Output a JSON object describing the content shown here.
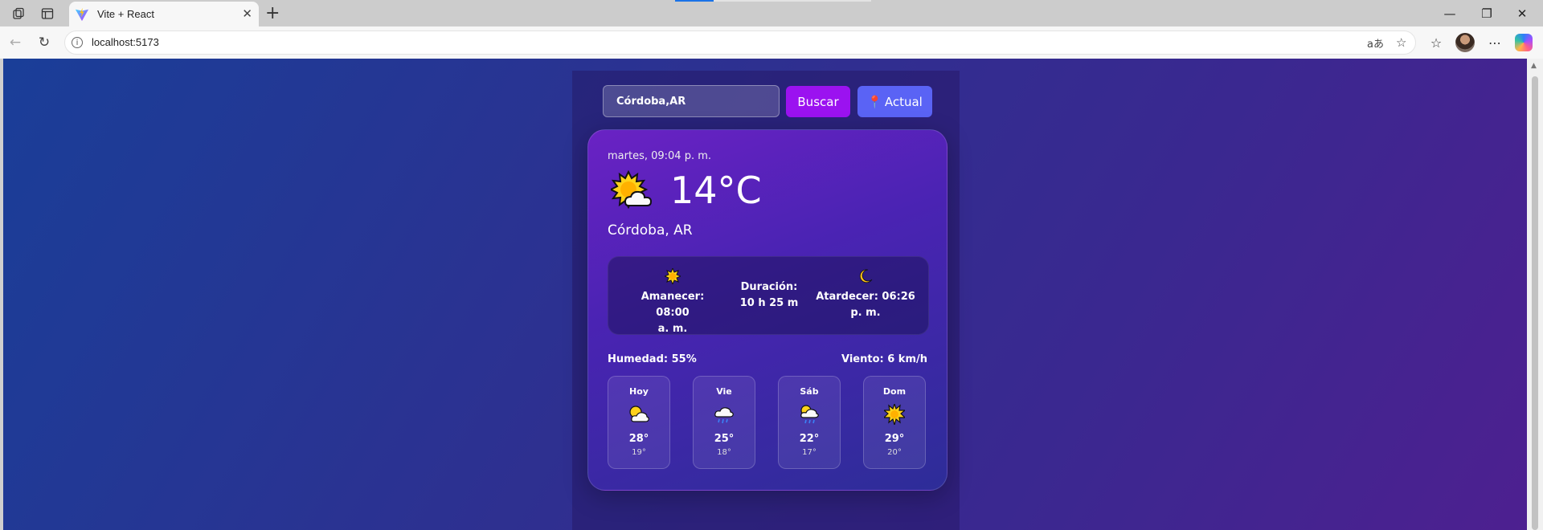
{
  "browser": {
    "tab_title": "Vite + React",
    "url": "localhost:5173"
  },
  "app": {
    "search": {
      "value": "Córdoba,AR",
      "search_label": "Buscar",
      "current_label": "Actual"
    },
    "weather": {
      "datetime": "martes, 09:04 p. m.",
      "temperature": "14°C",
      "city": "Córdoba, AR",
      "icon": "sun-behind-cloud-icon",
      "sunrise_line1": "Amanecer: 08:00",
      "sunrise_line2": "a. m.",
      "duration_line1": "Duración:",
      "duration_line2": "10 h 25 m",
      "sunset_line1": "Atardecer: 06:26",
      "sunset_line2": "p. m.",
      "humidity": "Humedad: 55%",
      "wind": "Viento: 6 km/h"
    },
    "forecast": [
      {
        "day": "Hoy",
        "icon": "sun-behind-cloud-icon",
        "max": "28°",
        "min": "19°"
      },
      {
        "day": "Vie",
        "icon": "rain-cloud-icon",
        "max": "25°",
        "min": "18°"
      },
      {
        "day": "Sáb",
        "icon": "sun-rain-cloud-icon",
        "max": "22°",
        "min": "17°"
      },
      {
        "day": "Dom",
        "icon": "sun-icon",
        "max": "29°",
        "min": "20°"
      }
    ],
    "colors": {
      "search_button": "#9b12f0",
      "current_button": "#5a63f5"
    }
  }
}
